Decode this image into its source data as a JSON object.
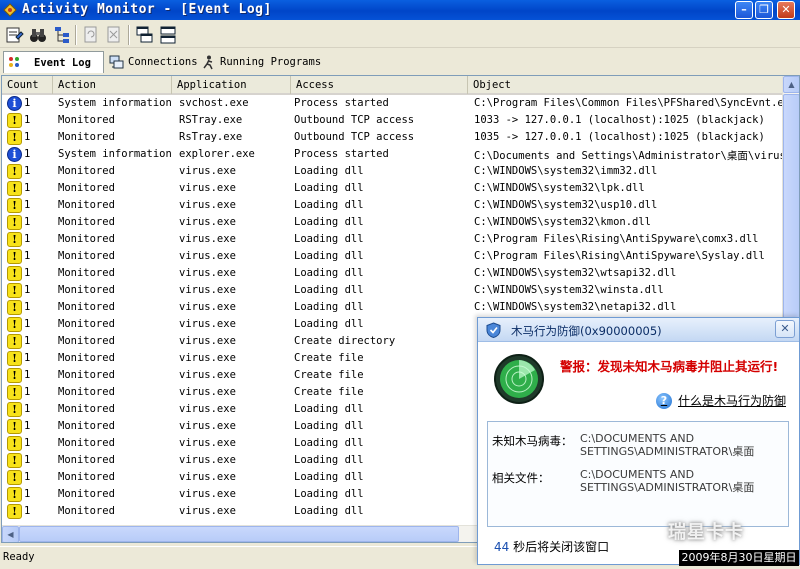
{
  "window": {
    "title": "Activity Monitor - [Event Log]"
  },
  "tabs": [
    {
      "label": "Event Log"
    },
    {
      "label": "Connections"
    },
    {
      "label": "Running Programs"
    }
  ],
  "columns": [
    "Count",
    "Action",
    "Application",
    "Access",
    "Object"
  ],
  "rows": [
    {
      "icon": "info",
      "count": "1",
      "action": "System information",
      "application": "svchost.exe",
      "access": "Process started",
      "object": "C:\\Program Files\\Common Files\\PFShared\\SyncEvnt.exe"
    },
    {
      "icon": "warn",
      "count": "1",
      "action": "Monitored",
      "application": "RSTray.exe",
      "access": "Outbound TCP access",
      "object": "1033 -> 127.0.0.1 (localhost):1025 (blackjack)"
    },
    {
      "icon": "warn",
      "count": "1",
      "action": "Monitored",
      "application": "RsTray.exe",
      "access": "Outbound TCP access",
      "object": "1035 -> 127.0.0.1 (localhost):1025 (blackjack)"
    },
    {
      "icon": "info",
      "count": "1",
      "action": "System information",
      "application": "explorer.exe",
      "access": "Process started",
      "object": "C:\\Documents and Settings\\Administrator\\桌面\\virus."
    },
    {
      "icon": "warn",
      "count": "1",
      "action": "Monitored",
      "application": "virus.exe",
      "access": "Loading dll",
      "object": "C:\\WINDOWS\\system32\\imm32.dll"
    },
    {
      "icon": "warn",
      "count": "1",
      "action": "Monitored",
      "application": "virus.exe",
      "access": "Loading dll",
      "object": "C:\\WINDOWS\\system32\\lpk.dll"
    },
    {
      "icon": "warn",
      "count": "1",
      "action": "Monitored",
      "application": "virus.exe",
      "access": "Loading dll",
      "object": "C:\\WINDOWS\\system32\\usp10.dll"
    },
    {
      "icon": "warn",
      "count": "1",
      "action": "Monitored",
      "application": "virus.exe",
      "access": "Loading dll",
      "object": "C:\\WINDOWS\\system32\\kmon.dll"
    },
    {
      "icon": "warn",
      "count": "1",
      "action": "Monitored",
      "application": "virus.exe",
      "access": "Loading dll",
      "object": "C:\\Program Files\\Rising\\AntiSpyware\\comx3.dll"
    },
    {
      "icon": "warn",
      "count": "1",
      "action": "Monitored",
      "application": "virus.exe",
      "access": "Loading dll",
      "object": "C:\\Program Files\\Rising\\AntiSpyware\\Syslay.dll"
    },
    {
      "icon": "warn",
      "count": "1",
      "action": "Monitored",
      "application": "virus.exe",
      "access": "Loading dll",
      "object": "C:\\WINDOWS\\system32\\wtsapi32.dll"
    },
    {
      "icon": "warn",
      "count": "1",
      "action": "Monitored",
      "application": "virus.exe",
      "access": "Loading dll",
      "object": "C:\\WINDOWS\\system32\\winsta.dll"
    },
    {
      "icon": "warn",
      "count": "1",
      "action": "Monitored",
      "application": "virus.exe",
      "access": "Loading dll",
      "object": "C:\\WINDOWS\\system32\\netapi32.dll"
    },
    {
      "icon": "warn",
      "count": "1",
      "action": "Monitored",
      "application": "virus.exe",
      "access": "Loading dll",
      "object": ""
    },
    {
      "icon": "warn",
      "count": "1",
      "action": "Monitored",
      "application": "virus.exe",
      "access": "Create directory",
      "object": ""
    },
    {
      "icon": "warn",
      "count": "1",
      "action": "Monitored",
      "application": "virus.exe",
      "access": "Create file",
      "object": ""
    },
    {
      "icon": "warn",
      "count": "1",
      "action": "Monitored",
      "application": "virus.exe",
      "access": "Create file",
      "object": ""
    },
    {
      "icon": "warn",
      "count": "1",
      "action": "Monitored",
      "application": "virus.exe",
      "access": "Create file",
      "object": ""
    },
    {
      "icon": "warn",
      "count": "1",
      "action": "Monitored",
      "application": "virus.exe",
      "access": "Loading dll",
      "object": ""
    },
    {
      "icon": "warn",
      "count": "1",
      "action": "Monitored",
      "application": "virus.exe",
      "access": "Loading dll",
      "object": ""
    },
    {
      "icon": "warn",
      "count": "1",
      "action": "Monitored",
      "application": "virus.exe",
      "access": "Loading dll",
      "object": ""
    },
    {
      "icon": "warn",
      "count": "1",
      "action": "Monitored",
      "application": "virus.exe",
      "access": "Loading dll",
      "object": ""
    },
    {
      "icon": "warn",
      "count": "1",
      "action": "Monitored",
      "application": "virus.exe",
      "access": "Loading dll",
      "object": ""
    },
    {
      "icon": "warn",
      "count": "1",
      "action": "Monitored",
      "application": "virus.exe",
      "access": "Loading dll",
      "object": ""
    },
    {
      "icon": "warn",
      "count": "1",
      "action": "Monitored",
      "application": "virus.exe",
      "access": "Loading dll",
      "object": ""
    }
  ],
  "status": "Ready",
  "popup": {
    "title": "木马行为防御(0x90000005)",
    "alert": "警报：发现未知木马病毒并阻止其运行!",
    "help_link": "什么是木马行为防御",
    "virus_label": "未知木马病毒：",
    "virus_value": "C:\\DOCUMENTS AND SETTINGS\\ADMINISTRATOR\\桌面",
    "file_label": "相关文件：",
    "file_value": "C:\\DOCUMENTS AND SETTINGS\\ADMINISTRATOR\\桌面",
    "countdown_num": "44",
    "countdown_text": " 秒后将关闭该窗口"
  },
  "watermark": "瑞星卡卡",
  "timestamp": "2009年8月30日星期日",
  "colors": {
    "titlebar": "#0045c8",
    "alert": "#d40000",
    "info_icon": "#1d4fd6",
    "warn_icon": "#f7e21a"
  }
}
